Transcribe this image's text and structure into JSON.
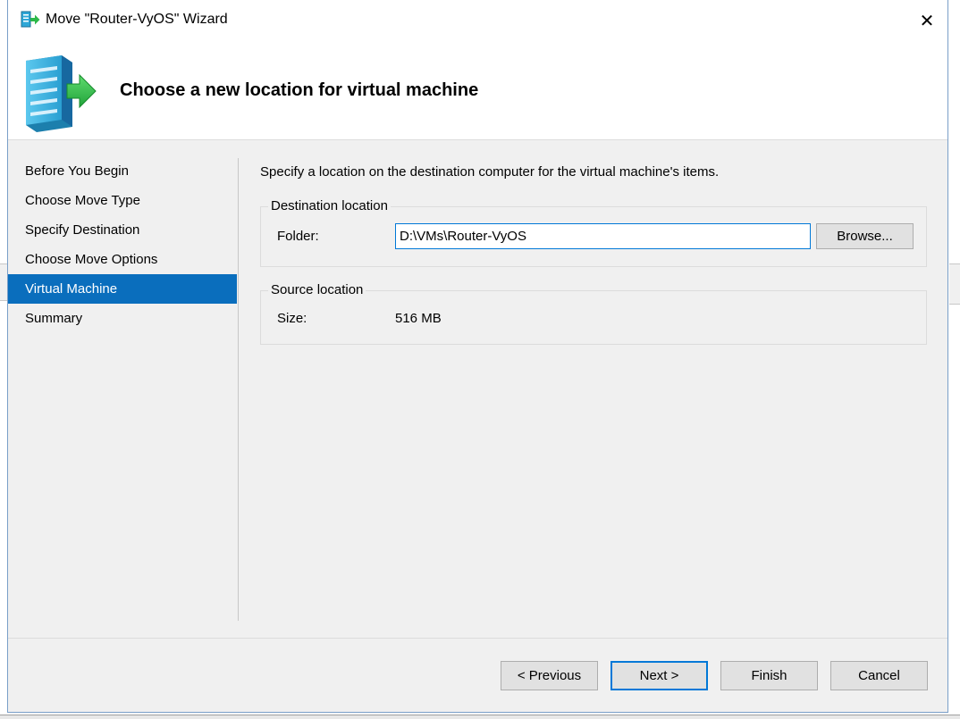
{
  "window": {
    "title": "Move \"Router-VyOS\" Wizard",
    "close_glyph": "✕",
    "icon": "server-move-icon"
  },
  "header": {
    "title": "Choose a new location for virtual machine",
    "icon": "server-arrow-icon"
  },
  "nav": {
    "items": [
      {
        "label": "Before You Begin",
        "active": false
      },
      {
        "label": "Choose Move Type",
        "active": false
      },
      {
        "label": "Specify Destination",
        "active": false
      },
      {
        "label": "Choose Move Options",
        "active": false
      },
      {
        "label": "Virtual Machine",
        "active": true
      },
      {
        "label": "Summary",
        "active": false
      }
    ]
  },
  "main": {
    "instruction": "Specify a location on the destination computer for the virtual machine's items.",
    "destination": {
      "legend": "Destination location",
      "folder_label": "Folder:",
      "folder_value": "D:\\VMs\\Router-VyOS",
      "browse_label": "Browse..."
    },
    "source": {
      "legend": "Source location",
      "size_label": "Size:",
      "size_value": "516 MB"
    }
  },
  "footer": {
    "previous_label": "< Previous",
    "next_label": "Next >",
    "finish_label": "Finish",
    "cancel_label": "Cancel"
  },
  "colors": {
    "accent": "#0078d7",
    "nav_active": "#0a6ebd",
    "panel_bg": "#f0f0f0",
    "arrow_green": "#2db84a",
    "server_cyan": "#2ea8d8"
  }
}
